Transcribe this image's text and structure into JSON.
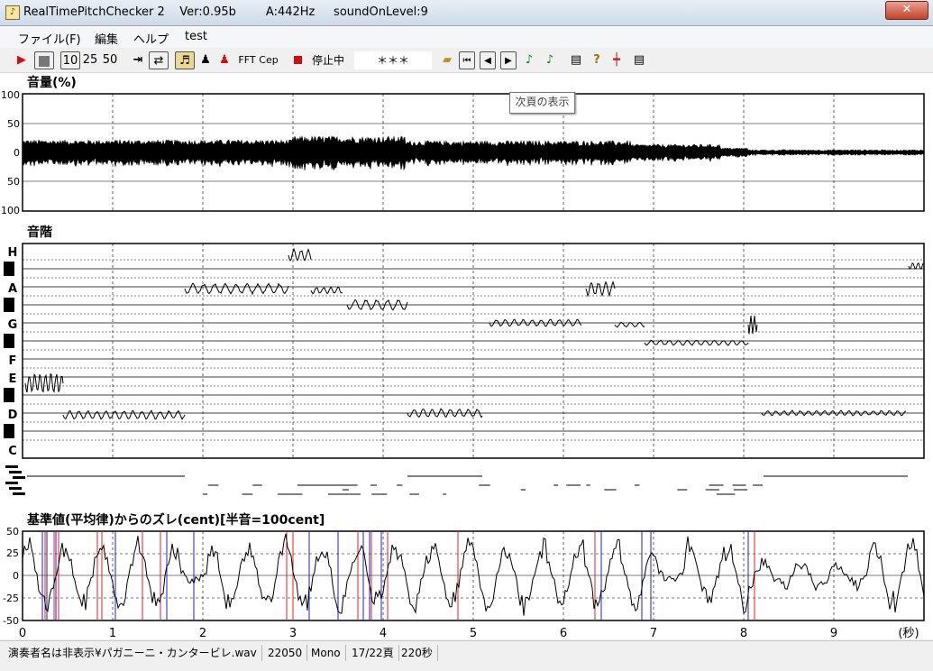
{
  "window": {
    "title": "RealTimePitchChecker 2    Ver:0.95b        A:442Hz     soundOnLevel:9",
    "close_label": "✕"
  },
  "menu": [
    "ファイル(F)",
    "編集",
    "ヘルプ",
    "test"
  ],
  "toolbar": {
    "speed_10": "10",
    "speed_25": "25",
    "speed_50": "50",
    "fft_label": "FFT",
    "cep_label": "Cep",
    "status_text": "停止中",
    "note_display": "＊＊＊",
    "icons": [
      "play-icon",
      "stop-icon",
      "goto-end-icon",
      "loop-icon",
      "violin-icon",
      "person-icon",
      "person-red-icon",
      "record-stop-icon",
      "folder-open-icon",
      "first-page-icon",
      "prev-page-icon",
      "next-page-icon",
      "note-green-icon",
      "note-green-2-icon",
      "print-icon",
      "help-icon",
      "marker-icon",
      "printer-icon"
    ]
  },
  "tooltip": "次頁の表示",
  "volume_panel": {
    "label": "音量(%)",
    "y_ticks": [
      "100",
      "50",
      "0",
      "50",
      "100"
    ]
  },
  "scale_panel": {
    "label": "音階",
    "notes": [
      "H",
      "A",
      "G",
      "F",
      "E",
      "D",
      "C"
    ]
  },
  "deviation_panel": {
    "label": "基準値(平均律)からのズレ(cent)[半音=100cent]",
    "y_ticks": [
      "50",
      "25",
      "0",
      "-25",
      "-50"
    ]
  },
  "time_axis": {
    "ticks": [
      "0",
      "1",
      "2",
      "3",
      "4",
      "5",
      "6",
      "7",
      "8",
      "9"
    ],
    "unit": "(秒)"
  },
  "statusbar": {
    "file": "演奏者名は非表示¥パガニーニ・カンタービレ.wav",
    "rate": "22050",
    "channels": "Mono",
    "page": "17/22頁",
    "duration": "220秒"
  },
  "colors": {
    "red_line": "#e02020",
    "blue_line": "#2020c0",
    "waveform": "#000000"
  }
}
